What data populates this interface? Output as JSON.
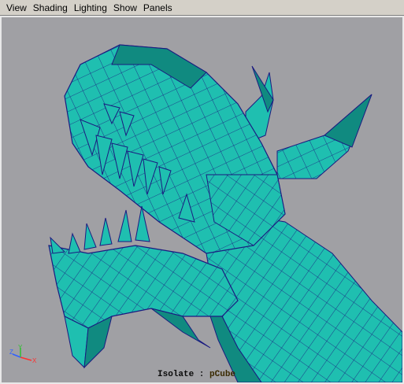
{
  "menubar": {
    "items": [
      {
        "label": "View"
      },
      {
        "label": "Shading"
      },
      {
        "label": "Lighting"
      },
      {
        "label": "Show"
      },
      {
        "label": "Panels"
      }
    ]
  },
  "viewport": {
    "background_color": "#a0a0a4",
    "mesh_color": "#1fbfb0",
    "mesh_shadow_color": "#108a80",
    "wire_color": "#1a1a80",
    "isolate": {
      "prefix": "Isolate : ",
      "value": "pCube"
    },
    "axis": {
      "x_label": "X",
      "y_label": "Y",
      "z_label": "Z",
      "x_color": "#ff3030",
      "y_color": "#30c030",
      "z_color": "#3060ff"
    }
  }
}
